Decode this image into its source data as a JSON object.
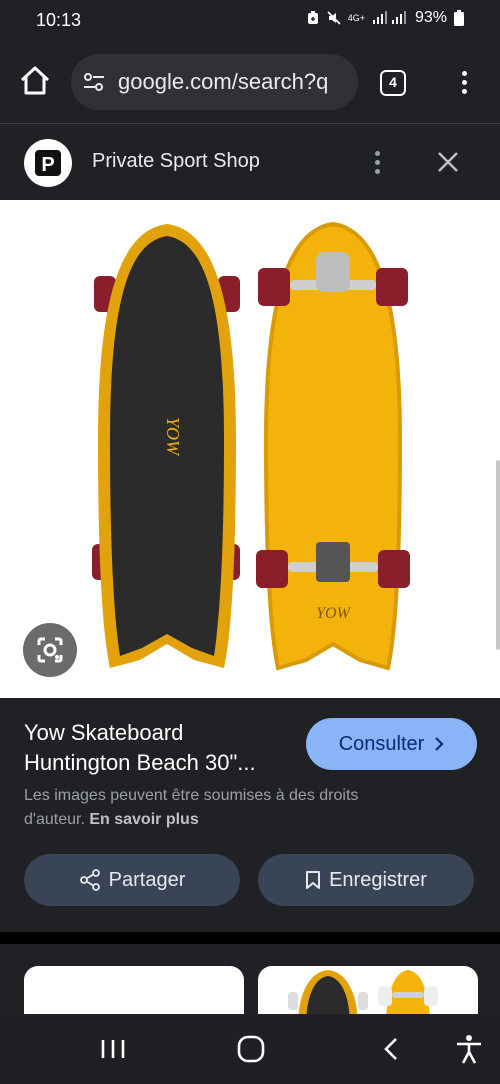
{
  "status_bar": {
    "time": "10:13",
    "network": "4G+",
    "battery": "93%",
    "icons": [
      "battery-saver-icon",
      "mute-icon",
      "signal-icon",
      "battery-icon"
    ]
  },
  "browser": {
    "url": "google.com/search?q",
    "tab_count": "4",
    "icons": [
      "home-icon",
      "site-settings-icon",
      "tabs-icon",
      "more-vert-icon"
    ]
  },
  "source": {
    "site_name": "Private Sport Shop",
    "favicon_letter": "P",
    "icons": [
      "more-vert-icon",
      "close-icon"
    ]
  },
  "result": {
    "title": "Yow Skateboard Huntington Beach 30\"...",
    "visit_label": "Consulter",
    "rights_text": "Les images peuvent être soumises à des droits d'auteur.",
    "learn_more": "En savoir plus",
    "share_label": "Partager",
    "save_label": "Enregistrer",
    "board_logo": "YOW"
  },
  "nav": {
    "icons": [
      "recents-icon",
      "home-icon",
      "back-icon",
      "accessibility-icon"
    ]
  },
  "colors": {
    "accent": "#8ab4f8",
    "deck_yellow": "#f4b30a",
    "grip_black": "#2a2a2a",
    "wheel_red": "#8a1f2b"
  }
}
